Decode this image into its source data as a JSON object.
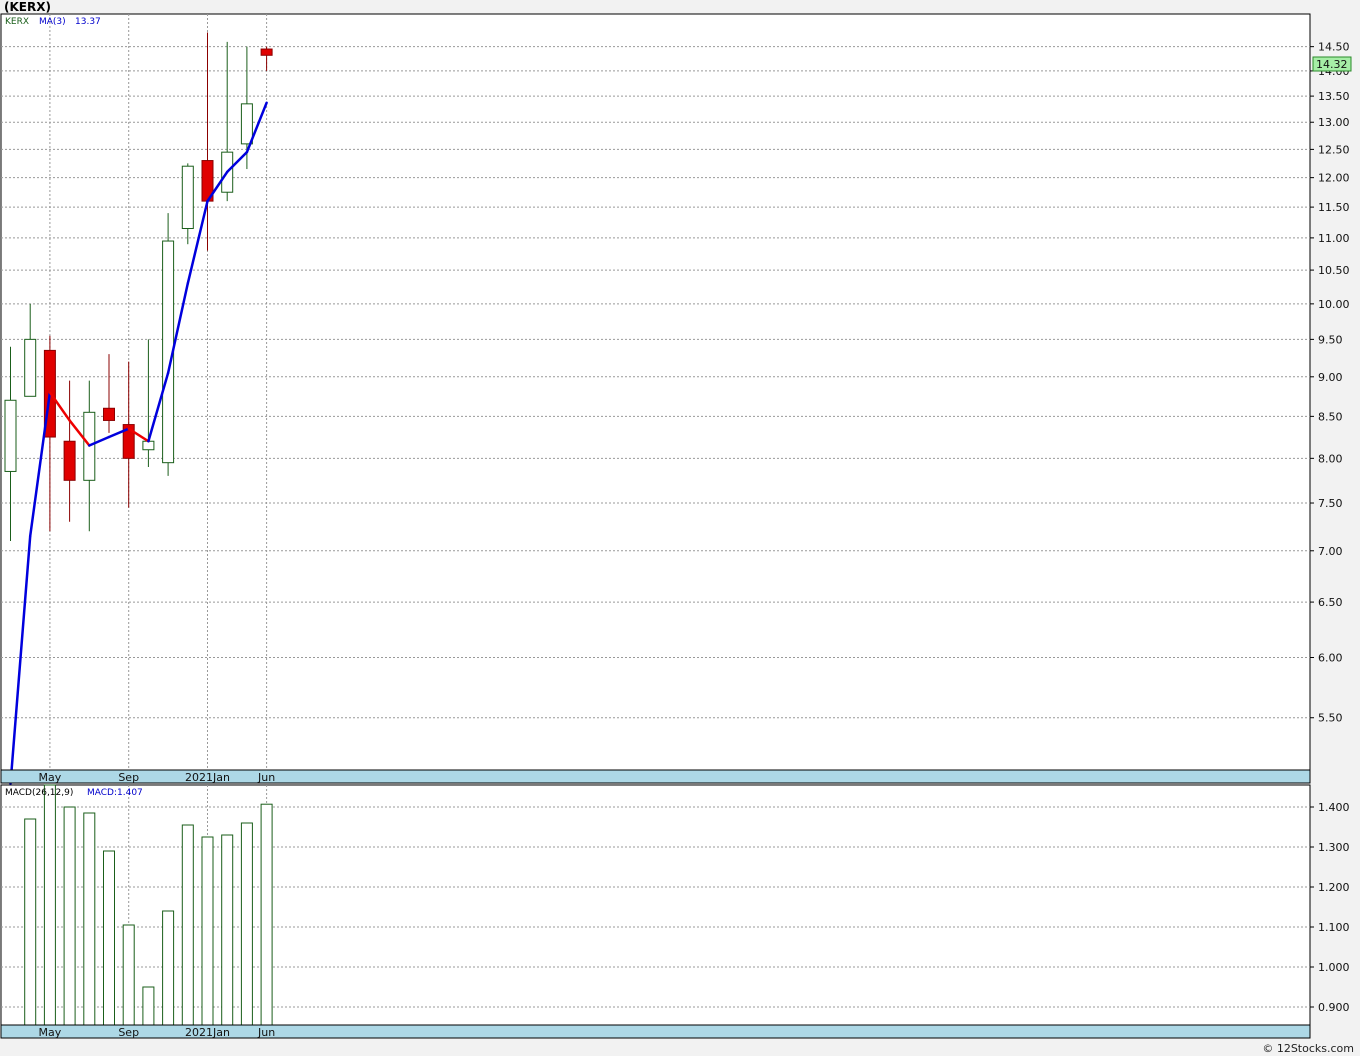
{
  "title": "(KERX)",
  "watermark": "© 12Stocks.com",
  "colors": {
    "up_candle": "#1a5e1a",
    "down_candle": "#e00000",
    "ma_up": "#0000dd",
    "ma_down": "#ee0000",
    "macd_bar": "#1a5e1a",
    "axis_band": "#add8e6",
    "grid": "#999999",
    "price_badge": "#a6eea6"
  },
  "chart_data": [
    {
      "type": "candlestick",
      "symbol_label": "KERX",
      "indicator_label": "MA(3)",
      "indicator_value": "13.37",
      "last_price": "14.32",
      "y_scale": "log",
      "ylim": [
        5.1,
        15.2
      ],
      "grid": true,
      "y_ticks": [
        "5.50",
        "6.00",
        "6.50",
        "7.00",
        "7.50",
        "8.00",
        "8.50",
        "9.00",
        "9.50",
        "10.00",
        "10.50",
        "11.00",
        "11.50",
        "12.00",
        "12.50",
        "13.00",
        "13.50",
        "14.00",
        "14.50"
      ],
      "x_ticks": [
        {
          "label": "May",
          "index": 2
        },
        {
          "label": "Sep",
          "index": 6
        },
        {
          "label": "2021Jan",
          "index": 10
        },
        {
          "label": "Jun",
          "index": 13
        }
      ],
      "candles": [
        {
          "open": 7.85,
          "high": 9.4,
          "low": 7.1,
          "close": 8.7
        },
        {
          "open": 8.75,
          "high": 10.0,
          "low": 8.75,
          "close": 9.5
        },
        {
          "open": 9.35,
          "high": 9.55,
          "low": 7.2,
          "close": 8.25
        },
        {
          "open": 8.2,
          "high": 8.95,
          "low": 7.3,
          "close": 7.75
        },
        {
          "open": 7.75,
          "high": 8.95,
          "low": 7.2,
          "close": 8.55
        },
        {
          "open": 8.6,
          "high": 9.3,
          "low": 8.3,
          "close": 8.45
        },
        {
          "open": 8.4,
          "high": 9.2,
          "low": 7.45,
          "close": 8.0
        },
        {
          "open": 8.1,
          "high": 9.5,
          "low": 7.9,
          "close": 8.2
        },
        {
          "open": 7.95,
          "high": 11.4,
          "low": 7.8,
          "close": 10.95
        },
        {
          "open": 11.15,
          "high": 12.25,
          "low": 10.9,
          "close": 12.2
        },
        {
          "open": 12.3,
          "high": 14.8,
          "low": 10.8,
          "close": 11.6
        },
        {
          "open": 11.75,
          "high": 14.6,
          "low": 11.6,
          "close": 12.45
        },
        {
          "open": 12.6,
          "high": 14.5,
          "low": 12.15,
          "close": 13.35
        },
        {
          "open": 14.45,
          "high": 14.5,
          "low": 14.0,
          "close": 14.32
        }
      ],
      "ma": [
        5.0,
        7.15,
        8.8,
        8.45,
        8.15,
        8.25,
        8.35,
        8.2,
        9.05,
        10.3,
        11.6,
        12.1,
        12.45,
        13.37
      ]
    },
    {
      "type": "bar",
      "indicator_label": "MACD(26,12,9)",
      "indicator_value_label": "MACD:1.407",
      "ylim": [
        0.855,
        1.455
      ],
      "grid": true,
      "y_ticks": [
        "0.900",
        "1.000",
        "1.100",
        "1.200",
        "1.300",
        "1.400"
      ],
      "x_ticks": [
        {
          "label": "May",
          "index": 2
        },
        {
          "label": "Sep",
          "index": 6
        },
        {
          "label": "2021Jan",
          "index": 10
        },
        {
          "label": "Jun",
          "index": 13
        }
      ],
      "values": [
        null,
        1.37,
        1.47,
        1.4,
        1.385,
        1.29,
        1.105,
        0.95,
        1.14,
        1.355,
        1.325,
        1.33,
        1.36,
        1.407
      ]
    }
  ]
}
